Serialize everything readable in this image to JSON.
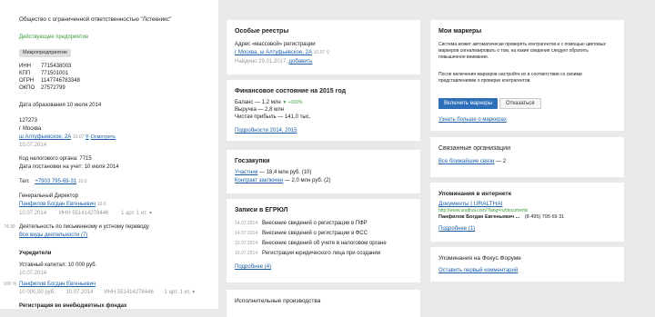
{
  "company": {
    "name": "Общество с ограниченной ответственностью \"Лстекникс\"",
    "status": "Действующее предприятие",
    "badge": "Микропредприятие",
    "ids": [
      {
        "k": "ИНН",
        "v": "7715438003"
      },
      {
        "k": "КПП",
        "v": "771501001"
      },
      {
        "k": "ОГРН",
        "v": "1147746783348"
      },
      {
        "k": "ОКПО",
        "v": "27572799"
      }
    ],
    "reg_date": "Дата образования  10 июля 2014",
    "address_zip": "127273",
    "address_city": "г Москва",
    "address_street": "ш Алтуфьевское, 2А",
    "address_tail": "10.07 ",
    "show_link": "Осмотреть",
    "address_date": "10.07.2014",
    "tax_code": "Код налогового органа: 7715",
    "tax_date": "Дата постановки на учет:  10 июля 2014",
    "tel_label": "Тел:",
    "tel": "+7903 795-69-31",
    "tel_suffix": "10.0",
    "director_title": "Генеральный Директор",
    "director_name": "Панфилов Богдан Евгеньевич",
    "director_meta1": "10.07.2014",
    "director_meta2": "ИНН 551414278446",
    "director_meta3": "1 арт. 1 ит. ▾",
    "side_time": "74:30",
    "activity": "Деятельность по письменному и устному переводу",
    "all_activities": "Все виды деятельности (7)",
    "founders_title": "Учредители",
    "capital": "Уставный капитал:  10 000 руб.",
    "capital_date": "10.07.2014",
    "side_pct": "100 %",
    "founder_name": "Панфилов Богдан Евгеньевич",
    "founder_meta1": "10 000,00 руб.",
    "founder_meta2": "10.07.2014",
    "founder_meta3": "ИНН 551414278446",
    "founder_meta4": "1 арт. 1 ит. ▾",
    "bottom_cut": "Регистрация во внебюджетных фондах"
  },
  "special": {
    "title": "Особые реестры",
    "line": "Адрес «массовой» регистрации",
    "addr": "г Москва, ш Алтуфьевское, 2А",
    "addr_tail": "10.07 ",
    "note": "Найдено 29.01.2017, ",
    "note_link": "добавить"
  },
  "finance": {
    "title": "Финансовое состояние на 2015 год",
    "balance": "Баланс — 1,2 млн",
    "balance_delta": "▼ +100%",
    "revenue": "Выручка — 2,8 млн",
    "profit": "Чистая прибыль — 141,0 тыс.",
    "more": "Подробности 2014,  2015"
  },
  "goszakupki": {
    "title": "Госзакупки",
    "participant_link": "Участник",
    "participant_rest": " — 18,4 млн руб.  (10)",
    "customer_link": "Контракт заключен",
    "customer_rest": " — 2,0 млн руб.  (2)"
  },
  "egrul": {
    "title": "Записи в ЕГРЮЛ",
    "rows": [
      {
        "date": "14.07.2014",
        "text": "Внесение сведений о регистрации в ПФР"
      },
      {
        "date": "14.07.2014",
        "text": "Внесение сведений о регистрации в ФСС"
      },
      {
        "date": "10.07.2014",
        "text": "Внесение сведений об учете в налоговом органе"
      },
      {
        "date": "10.07.2014",
        "text": "Регистрация юридического лица при создании"
      }
    ],
    "more": "Подробнее (4)"
  },
  "enforcement": {
    "title": "Исполнительные производства"
  },
  "markers": {
    "title": "Мои маркеры",
    "desc": "Система может автоматически проверять контрагентов и с помощью цветовых маркеров сигнализировать о том, на какие сведения следует обратить повышенное внимание.",
    "desc2": "После включения маркеров настройте их в соответствии со своими представлениями о проверке контрагентов.",
    "enable": "Включить маркеры",
    "decline": "Отказаться",
    "more": "Узнать больше о маркерах"
  },
  "related": {
    "title": "Связанные организации",
    "link": "Все ближайшие связи",
    "count": " — 2"
  },
  "mentions": {
    "title": "Упоминания в интернете",
    "doc_link": "Документы | URALTHAI",
    "url": "http://www.uralthai.com/?lang=ru/documents",
    "person": "Панфилов Богдан Евгеньевич ...",
    "phone": "(8 495) 795 69 31",
    "more": "Подробнее (1)"
  },
  "forum": {
    "title": "Упоминания на Фокус.Форуме",
    "link": "Оставить первый комментарий"
  }
}
